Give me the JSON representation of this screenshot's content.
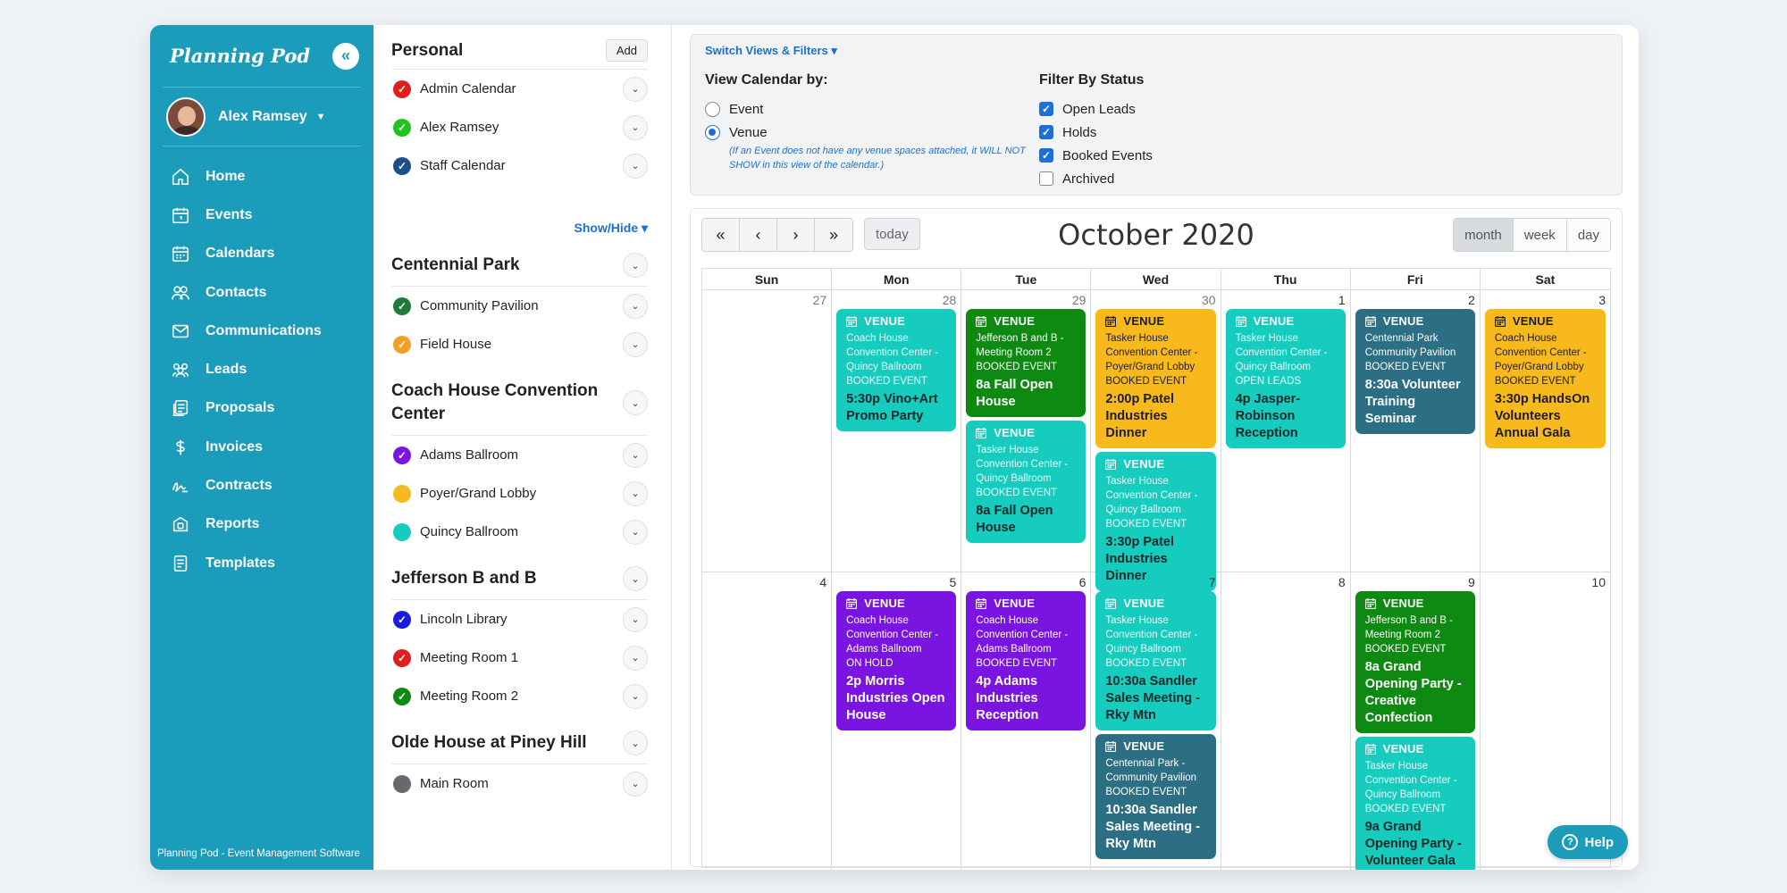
{
  "sidebar": {
    "logo": "Planning Pod",
    "user_name": "Alex Ramsey",
    "nav": [
      {
        "label": "Home",
        "icon": "home-icon"
      },
      {
        "label": "Events",
        "icon": "events-icon"
      },
      {
        "label": "Calendars",
        "icon": "calendar-icon"
      },
      {
        "label": "Contacts",
        "icon": "contacts-icon"
      },
      {
        "label": "Communications",
        "icon": "mail-icon"
      },
      {
        "label": "Leads",
        "icon": "leads-icon"
      },
      {
        "label": "Proposals",
        "icon": "proposals-icon"
      },
      {
        "label": "Invoices",
        "icon": "dollar-icon"
      },
      {
        "label": "Contracts",
        "icon": "signature-icon"
      },
      {
        "label": "Reports",
        "icon": "reports-icon"
      },
      {
        "label": "Templates",
        "icon": "templates-icon"
      }
    ],
    "footer": "Planning Pod - Event Management Software"
  },
  "calendars": {
    "personal_title": "Personal",
    "add_label": "Add",
    "personal": [
      {
        "label": "Admin Calendar",
        "color": "#e11d1d",
        "check": true
      },
      {
        "label": "Alex Ramsey",
        "color": "#22c31e",
        "check": true
      },
      {
        "label": "Staff Calendar",
        "color": "#1b4f8c",
        "check": true
      }
    ],
    "show_hide": "Show/Hide",
    "groups": [
      {
        "title": "Centennial Park",
        "items": [
          {
            "label": "Community Pavilion",
            "color": "#1f7a3a",
            "check": true
          },
          {
            "label": "Field House",
            "color": "#f4a024",
            "check": true
          }
        ]
      },
      {
        "title": "Coach House Convention Center",
        "items": [
          {
            "label": "Adams Ballroom",
            "color": "#7a14e0",
            "check": true
          },
          {
            "label": "Poyer/Grand Lobby",
            "color": "#f7b91c",
            "check": false
          },
          {
            "label": "Quincy Ballroom",
            "color": "#16ccbf",
            "check": false
          }
        ]
      },
      {
        "title": "Jefferson B and B",
        "items": [
          {
            "label": "Lincoln Library",
            "color": "#1a1ae0",
            "check": true
          },
          {
            "label": "Meeting Room 1",
            "color": "#e11d1d",
            "check": true
          },
          {
            "label": "Meeting Room 2",
            "color": "#0e8a13",
            "check": true
          }
        ]
      },
      {
        "title": "Olde House at Piney Hill",
        "items": [
          {
            "label": "Main Room",
            "color": "#666a70",
            "check": false
          }
        ]
      }
    ]
  },
  "filters": {
    "switch_label": "Switch Views & Filters",
    "view_by_title": "View Calendar by:",
    "view_options": [
      {
        "label": "Event",
        "selected": false
      },
      {
        "label": "Venue",
        "selected": true
      }
    ],
    "venue_note": "(If an Event does not have any venue spaces attached, it WILL NOT SHOW in this view of the calendar.)",
    "status_title": "Filter By Status",
    "status_options": [
      {
        "label": "Open Leads",
        "checked": true
      },
      {
        "label": "Holds",
        "checked": true
      },
      {
        "label": "Booked Events",
        "checked": true
      },
      {
        "label": "Archived",
        "checked": false
      }
    ]
  },
  "calendar": {
    "nav_buttons": [
      "«",
      "‹",
      "›",
      "»"
    ],
    "today": "today",
    "title": "October 2020",
    "views": [
      {
        "label": "month",
        "active": true
      },
      {
        "label": "week",
        "active": false
      },
      {
        "label": "day",
        "active": false
      }
    ],
    "days_of_week": [
      "Sun",
      "Mon",
      "Tue",
      "Wed",
      "Thu",
      "Fri",
      "Sat"
    ],
    "weeks": [
      [
        {
          "num": "27",
          "other": true,
          "events": []
        },
        {
          "num": "28",
          "other": true,
          "events": [
            {
              "tag": "VENUE",
              "color": "teal",
              "desc": [
                "Coach House",
                "Convention Center -",
                "Quincy Ballroom",
                "BOOKED EVENT"
              ],
              "name": "5:30p Vino+Art Promo Party"
            }
          ]
        },
        {
          "num": "29",
          "other": true,
          "events": [
            {
              "tag": "VENUE",
              "color": "green",
              "desc": [
                "Jefferson B and B -",
                "Meeting Room 2",
                "BOOKED EVENT"
              ],
              "name": "8a Fall Open House"
            },
            {
              "tag": "VENUE",
              "color": "teal",
              "desc": [
                "Tasker House",
                "Convention Center -",
                "Quincy Ballroom",
                "BOOKED EVENT"
              ],
              "name": "8a Fall Open House"
            }
          ]
        },
        {
          "num": "30",
          "other": true,
          "events": [
            {
              "tag": "VENUE",
              "color": "yellow",
              "desc": [
                "Tasker House",
                "Convention Center -",
                "Poyer/Grand Lobby",
                "BOOKED EVENT"
              ],
              "name": "2:00p Patel Industries Dinner"
            },
            {
              "tag": "VENUE",
              "color": "teal",
              "desc": [
                "Tasker House",
                "Convention Center -",
                "Quincy Ballroom",
                "BOOKED EVENT"
              ],
              "name": "3:30p Patel Industries Dinner"
            }
          ]
        },
        {
          "num": "1",
          "other": false,
          "events": [
            {
              "tag": "VENUE",
              "color": "teal",
              "desc": [
                "Tasker House",
                "Convention Center -",
                "Quincy Ballroom",
                "OPEN LEADS"
              ],
              "name": "4p Jasper-Robinson Reception"
            }
          ]
        },
        {
          "num": "2",
          "other": false,
          "events": [
            {
              "tag": "VENUE",
              "color": "slate",
              "desc": [
                "Centennial Park",
                "Community Pavilion",
                "BOOKED EVENT"
              ],
              "name": "8:30a Volunteer Training Seminar"
            }
          ]
        },
        {
          "num": "3",
          "other": false,
          "events": [
            {
              "tag": "VENUE",
              "color": "yellow",
              "desc": [
                "Coach House",
                "Convention Center -",
                "Poyer/Grand Lobby",
                "BOOKED EVENT"
              ],
              "name": "3:30p HandsOn Volunteers Annual Gala"
            }
          ]
        }
      ],
      [
        {
          "num": "4",
          "other": false,
          "events": []
        },
        {
          "num": "5",
          "other": false,
          "events": [
            {
              "tag": "VENUE",
              "color": "purple",
              "desc": [
                "Coach House",
                "Convention Center -",
                "Adams Ballroom",
                "ON HOLD"
              ],
              "name": "2p Morris Industries Open House"
            }
          ]
        },
        {
          "num": "6",
          "other": false,
          "events": [
            {
              "tag": "VENUE",
              "color": "purple",
              "desc": [
                "Coach House",
                "Convention Center -",
                "Adams Ballroom",
                "BOOKED EVENT"
              ],
              "name": "4p Adams Industries Reception"
            }
          ]
        },
        {
          "num": "7",
          "other": false,
          "events": [
            {
              "tag": "VENUE",
              "color": "teal",
              "desc": [
                "Tasker House",
                "Convention Center -",
                "Quincy Ballroom",
                "BOOKED EVENT"
              ],
              "name": "10:30a Sandler Sales Meeting - Rky Mtn"
            },
            {
              "tag": "VENUE",
              "color": "slate",
              "desc": [
                "Centennial Park -",
                "Community Pavilion",
                "BOOKED EVENT"
              ],
              "name": "10:30a Sandler Sales Meeting - Rky Mtn"
            }
          ]
        },
        {
          "num": "8",
          "other": false,
          "events": []
        },
        {
          "num": "9",
          "other": false,
          "events": [
            {
              "tag": "VENUE",
              "color": "green",
              "desc": [
                "Jefferson B and B -",
                "Meeting Room 2",
                "BOOKED EVENT"
              ],
              "name": "8a Grand Opening Party - Creative Confection"
            },
            {
              "tag": "VENUE",
              "color": "teal",
              "desc": [
                "Tasker House",
                "Convention Center -",
                "Quincy Ballroom",
                "BOOKED EVENT"
              ],
              "name": "9a Grand Opening Party - Volunteer Gala"
            }
          ]
        },
        {
          "num": "10",
          "other": false,
          "events": []
        }
      ]
    ]
  },
  "help_label": "Help"
}
